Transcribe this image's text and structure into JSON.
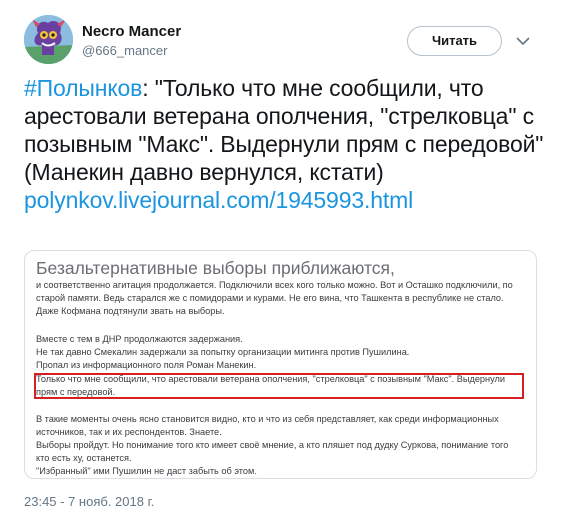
{
  "user": {
    "display_name": "Necro Mancer",
    "screen_name": "@666_mancer"
  },
  "follow_button": {
    "label": "Читать"
  },
  "tweet": {
    "hashtag": "#Полынков",
    "text": ": \"Только что мне сообщили, что арестовали ветерана ополчения, \"стрелковца\" с позывным \"Макс\". Выдернули прям с передовой\" (Манекин давно вернулся, кстати) ",
    "link": "polynkov.livejournal.com/1945993.html"
  },
  "embed": {
    "title": "Безальтернативные выборы приближаются,",
    "para1": [
      "и соответственно агитация продолжается. Подключили всех кого только можно. Вот и Осташко подключили, по",
      "старой памяти. Ведь старался же с помидорами и курами. Не его вина, что Ташкента в республике не стало.",
      "Даже Кофмана подтянули звать на выборы."
    ],
    "para2": [
      "Вместе с тем в ДНР продолжаются задержания.",
      "Не так давно Смекалин задержали за попытку организации митинга против Пушилина.",
      "Пропал из информационного поля Роман Манекин."
    ],
    "para3": [
      "Только что мне сообщили, что арестовали ветерана ополчения, \"стрелковца\" с позывным \"Макс\". Выдернули",
      "прям с передовой."
    ],
    "para4": [
      "В такие моменты очень ясно становится видно, кто и что из себя представляет, как среди информационных",
      "источников, так и их респондентов. Знаете.",
      "Выборы пройдут. Но понимание того кто имеет своё мнение, а кто пляшет под дудку Суркова, понимание того",
      "кто есть ху, останется.",
      "\"Избранный\" ими Пушилин не даст забыть об этом."
    ]
  },
  "timestamp": "23:45 - 7 нояб. 2018 г.",
  "icons": {
    "avatar": "avatar-image",
    "chevron": "chevron-down-icon"
  },
  "colors": {
    "link": "#1b95e0",
    "secondary_text": "#657786",
    "highlight_border": "#d42020"
  }
}
